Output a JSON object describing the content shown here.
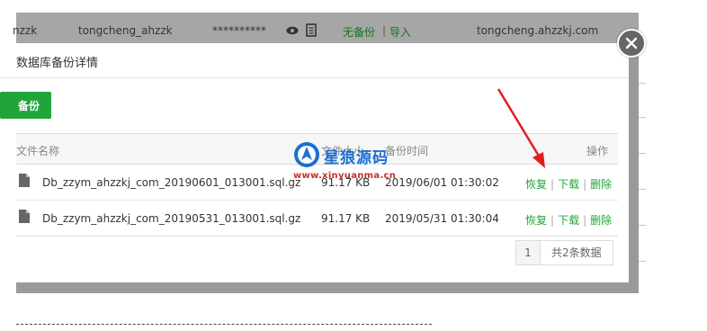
{
  "background_row": {
    "username_partial": "nzzk",
    "username": "tongcheng_ahzzk",
    "password_masked": "**********",
    "backup_status": "无备份",
    "separator": "|",
    "import_label": "导入",
    "domain": "tongcheng.ahzzkj.com"
  },
  "modal": {
    "title": "数据库备份详情",
    "backup_button": "备份",
    "columns": {
      "file_name": "文件名称",
      "size": "文件大小",
      "time": "备份时间",
      "actions": "操作"
    },
    "rows": [
      {
        "file_name": "Db_zzym_ahzzkj_com_20190601_013001.sql.gz",
        "size": "91.17 KB",
        "time": "2019/06/01 01:30:02",
        "restore": "恢复",
        "download": "下载",
        "delete": "删除"
      },
      {
        "file_name": "Db_zzym_ahzzkj_com_20190531_013001.sql.gz",
        "size": "91.17 KB",
        "time": "2019/05/31 01:30:04",
        "restore": "恢复",
        "download": "下载",
        "delete": "删除"
      }
    ],
    "pager": {
      "current_page": "1",
      "total": "共2条数据"
    }
  },
  "watermark": {
    "title": "星狼源码",
    "url": "www.xinyuanma.cn"
  },
  "colors": {
    "accent_green": "#20a53a",
    "arrow_red": "#e02020",
    "backdrop": "#9a9a9a"
  },
  "dashed_line": "---------------------------------------------------------------------------------"
}
